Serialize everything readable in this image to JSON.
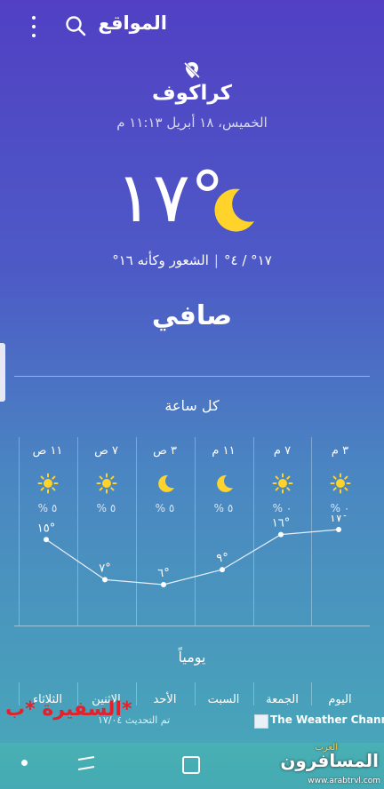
{
  "topbar": {
    "title": "المواقع"
  },
  "location": {
    "city": "كراكوف",
    "datetime": "الخميس، ١٨ أبريل ١١:١٣ م"
  },
  "current": {
    "temp": "١٧°",
    "minmax": "١٧° / ٤°",
    "feels_like": "الشعور وكأنه ١٦°",
    "condition": "صافي"
  },
  "hourly": {
    "title": "كل ساعة",
    "items": [
      {
        "time": "٣ م",
        "icon": "sun-icon",
        "precip": "٠ %",
        "temp": "١٧°",
        "value": 17
      },
      {
        "time": "٧ م",
        "icon": "sun-icon",
        "precip": "٠ %",
        "temp": "١٦°",
        "value": 16
      },
      {
        "time": "١١ م",
        "icon": "moon-icon",
        "precip": "٥ %",
        "temp": "٩°",
        "value": 9
      },
      {
        "time": "٣ ص",
        "icon": "moon-icon",
        "precip": "٥ %",
        "temp": "٦°",
        "value": 6
      },
      {
        "time": "٧ ص",
        "icon": "sun-icon",
        "precip": "٥ %",
        "temp": "٧°",
        "value": 7
      },
      {
        "time": "١١ ص",
        "icon": "sun-icon",
        "precip": "٥ %",
        "temp": "١٥°",
        "value": 15
      }
    ]
  },
  "daily": {
    "title": "يومياً",
    "days": [
      "اليوم",
      "الجمعة",
      "السبت",
      "الأحد",
      "الاثنين",
      "الثلاثاء"
    ]
  },
  "footer": {
    "updated": "تم التحديث ١٧/٠٤",
    "provider": "The Weather Channel"
  },
  "watermark": {
    "user": "السفيرة *ب*",
    "brand": "المسافرون",
    "brand_sub": "العرب",
    "site": "www.arabtrvl.com"
  },
  "colors": {
    "sun": "#ffd32a",
    "moon": "#ffd32a",
    "accent": "#4f47c4"
  }
}
